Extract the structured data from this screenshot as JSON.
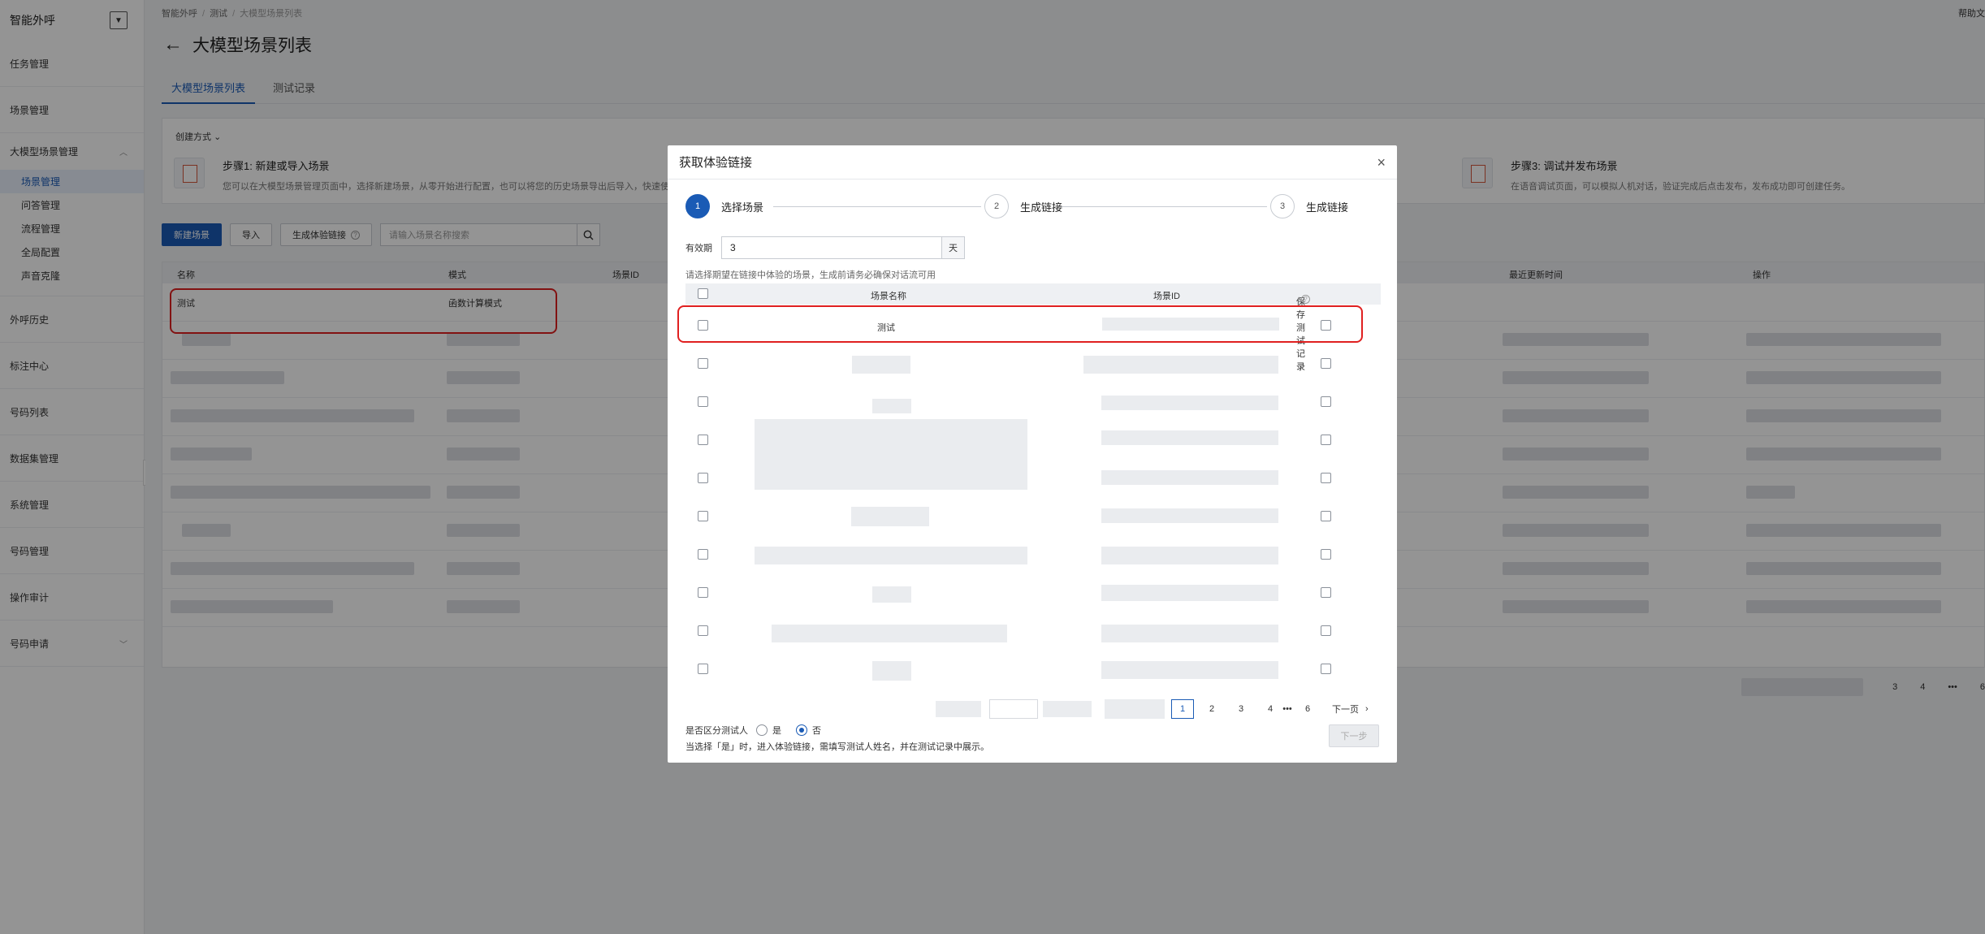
{
  "sidebar": {
    "title": "智能外呼",
    "items_top": [
      "任务管理",
      "场景管理"
    ],
    "group": {
      "label": "大模型场景管理",
      "subs": [
        "场景管理",
        "问答管理",
        "流程管理",
        "全局配置",
        "声音克隆"
      ]
    },
    "items_bottom": [
      "外呼历史",
      "标注中心",
      "号码列表",
      "数据集管理",
      "系统管理",
      "号码管理",
      "操作审计"
    ],
    "last_item": "号码申请"
  },
  "header": {
    "breadcrumb": [
      "智能外呼",
      "测试",
      "大模型场景列表"
    ],
    "help": "帮助文",
    "title": "大模型场景列表",
    "tabs": [
      "大模型场景列表",
      "测试记录"
    ]
  },
  "create": {
    "label": "创建方式",
    "step1_title": "步骤1: 新建或导入场景",
    "step1_desc": "您可以在大模型场景管理页面中，选择新建场景，从零开始进行配置，也可以将您的历史场景导出后导入，快速使",
    "step3_title": "步骤3: 调试并发布场景",
    "step3_desc": "在语音调试页面，可以模拟人机对话，验证完成后点击发布，发布成功即可创建任务。"
  },
  "toolbar": {
    "new_label": "新建场景",
    "import_label": "导入",
    "gen_label": "生成体验链接",
    "search_placeholder": "请输入场景名称搜索"
  },
  "bg_table": {
    "columns": [
      "名称",
      "模式",
      "场景ID",
      "最近更新时间",
      "操作"
    ],
    "first_row": {
      "name": "测试",
      "mode": "函数计算模式"
    },
    "pager": [
      "3",
      "4",
      "•••",
      "6"
    ]
  },
  "modal": {
    "title": "获取体验链接",
    "steps": [
      {
        "num": "1",
        "label": "选择场景"
      },
      {
        "num": "2",
        "label": "生成链接"
      },
      {
        "num": "3",
        "label": "生成链接"
      }
    ],
    "validity_label": "有效期",
    "validity_value": "3",
    "validity_unit": "天",
    "hint": "请选择期望在链接中体验的场景，生成前请务必确保对话流可用",
    "columns": [
      "场景名称",
      "场景ID",
      "保存测试记录"
    ],
    "first_row_name": "测试",
    "pager": {
      "pages": [
        "1",
        "2",
        "3",
        "4",
        "•••",
        "6"
      ],
      "next": "下一页"
    },
    "tester_label": "是否区分测试人",
    "tester_yes": "是",
    "tester_no": "否",
    "tester_selected": "否",
    "tester_note": "当选择「是」时，进入体验链接，需填写测试人姓名，并在测试记录中展示。",
    "next_label": "下一步"
  }
}
